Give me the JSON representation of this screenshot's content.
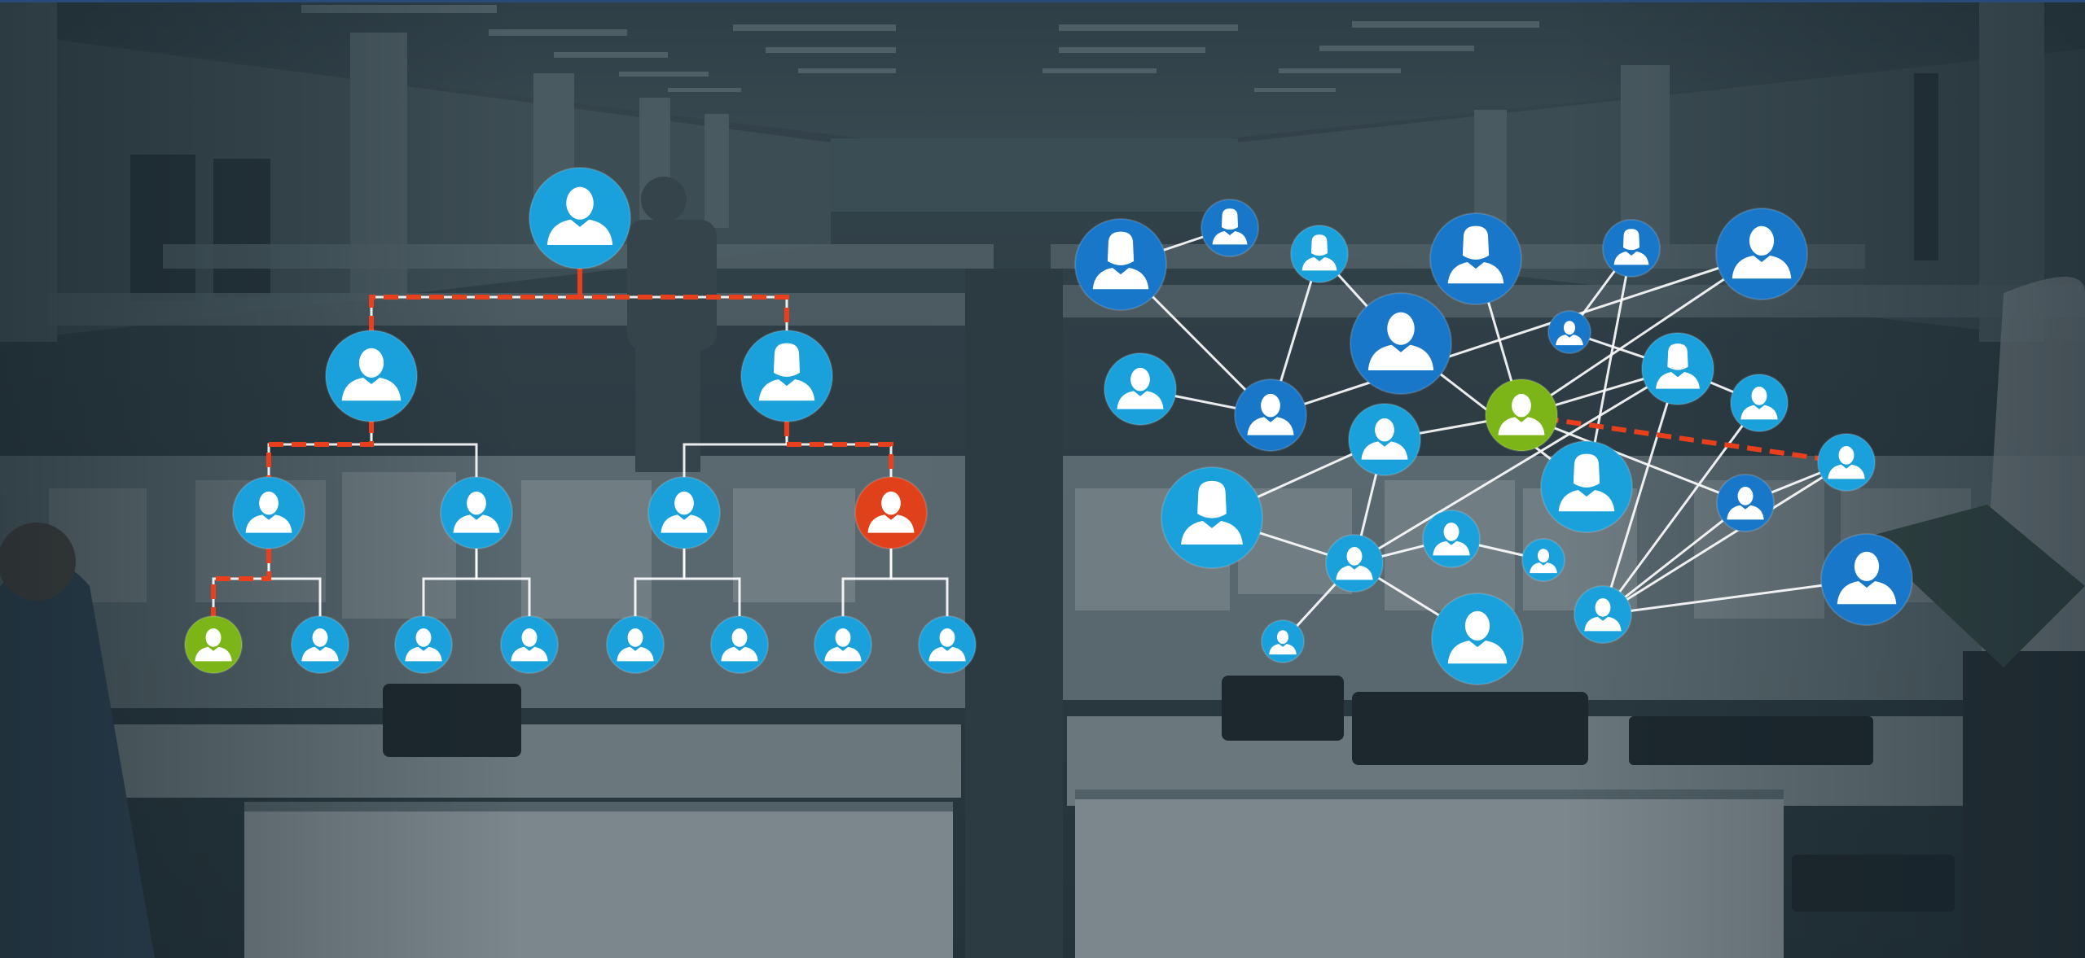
{
  "colors": {
    "blue_light": "#1aa0da",
    "blue_dark": "#1877c9",
    "green": "#7cb518",
    "red": "#e0411a",
    "dashed_red": "#e8401c",
    "link_white": "#ffffff",
    "overlay": "#23343c"
  },
  "icon": "person-icon",
  "hierarchy": {
    "nodes": [
      {
        "id": "h_root",
        "color": "blue_light",
        "size": "xl",
        "shape": "man"
      },
      {
        "id": "h_l1a",
        "color": "blue_light",
        "size": "lg",
        "shape": "man"
      },
      {
        "id": "h_l1b",
        "color": "blue_light",
        "size": "lg",
        "shape": "woman"
      },
      {
        "id": "h_l2a",
        "color": "blue_light",
        "size": "md",
        "shape": "man"
      },
      {
        "id": "h_l2b",
        "color": "blue_light",
        "size": "md",
        "shape": "man"
      },
      {
        "id": "h_l2c",
        "color": "blue_light",
        "size": "md",
        "shape": "man"
      },
      {
        "id": "h_l2d",
        "color": "red",
        "size": "md",
        "shape": "man"
      },
      {
        "id": "h_l3a",
        "color": "green",
        "size": "sm",
        "shape": "man"
      },
      {
        "id": "h_l3b",
        "color": "blue_light",
        "size": "sm",
        "shape": "man"
      },
      {
        "id": "h_l3c",
        "color": "blue_light",
        "size": "sm",
        "shape": "man"
      },
      {
        "id": "h_l3d",
        "color": "blue_light",
        "size": "sm",
        "shape": "man"
      },
      {
        "id": "h_l3e",
        "color": "blue_light",
        "size": "sm",
        "shape": "man"
      },
      {
        "id": "h_l3f",
        "color": "blue_light",
        "size": "sm",
        "shape": "man"
      },
      {
        "id": "h_l3g",
        "color": "blue_light",
        "size": "sm",
        "shape": "man"
      },
      {
        "id": "h_l3h",
        "color": "blue_light",
        "size": "sm",
        "shape": "man"
      }
    ],
    "links": [
      [
        "h_root",
        "h_l1a"
      ],
      [
        "h_root",
        "h_l1b"
      ],
      [
        "h_l1a",
        "h_l2a"
      ],
      [
        "h_l1a",
        "h_l2b"
      ],
      [
        "h_l1b",
        "h_l2c"
      ],
      [
        "h_l1b",
        "h_l2d"
      ],
      [
        "h_l2a",
        "h_l3a"
      ],
      [
        "h_l2a",
        "h_l3b"
      ],
      [
        "h_l2b",
        "h_l3c"
      ],
      [
        "h_l2b",
        "h_l3d"
      ],
      [
        "h_l2c",
        "h_l3e"
      ],
      [
        "h_l2c",
        "h_l3f"
      ],
      [
        "h_l2d",
        "h_l3g"
      ],
      [
        "h_l2d",
        "h_l3h"
      ]
    ],
    "highlight_path": [
      "h_l3a",
      "h_l2a",
      "h_l1a",
      "h_root",
      "h_l1b",
      "h_l2d"
    ]
  },
  "network": {
    "nodes": [
      {
        "id": "n1",
        "color": "blue_dark",
        "size": "lg",
        "shape": "woman"
      },
      {
        "id": "n2",
        "color": "blue_dark",
        "size": "sm",
        "shape": "woman"
      },
      {
        "id": "n3",
        "color": "blue_light",
        "size": "sm",
        "shape": "woman"
      },
      {
        "id": "n4",
        "color": "blue_dark",
        "size": "lg",
        "shape": "woman"
      },
      {
        "id": "n5",
        "color": "blue_dark",
        "size": "sm",
        "shape": "woman"
      },
      {
        "id": "n6",
        "color": "blue_dark",
        "size": "xl",
        "shape": "man"
      },
      {
        "id": "n7",
        "color": "blue_dark",
        "size": "xs",
        "shape": "man"
      },
      {
        "id": "n8",
        "color": "blue_light",
        "size": "md",
        "shape": "man"
      },
      {
        "id": "n9",
        "color": "blue_dark",
        "size": "md",
        "shape": "man"
      },
      {
        "id": "n10",
        "color": "blue_dark",
        "size": "lg",
        "shape": "man"
      },
      {
        "id": "n11",
        "color": "green",
        "size": "md",
        "shape": "man"
      },
      {
        "id": "n12",
        "color": "blue_light",
        "size": "md",
        "shape": "woman"
      },
      {
        "id": "n13",
        "color": "blue_light",
        "size": "sm",
        "shape": "man"
      },
      {
        "id": "n14",
        "color": "blue_light",
        "size": "sm",
        "shape": "man"
      },
      {
        "id": "n15",
        "color": "blue_light",
        "size": "md",
        "shape": "man"
      },
      {
        "id": "n16",
        "color": "blue_light",
        "size": "xl",
        "shape": "woman"
      },
      {
        "id": "n17",
        "color": "blue_light",
        "size": "lg",
        "shape": "woman"
      },
      {
        "id": "n18",
        "color": "blue_dark",
        "size": "sm",
        "shape": "man"
      },
      {
        "id": "n19",
        "color": "blue_light",
        "size": "sm",
        "shape": "man"
      },
      {
        "id": "n20",
        "color": "blue_light",
        "size": "sm",
        "shape": "man"
      },
      {
        "id": "n21",
        "color": "blue_light",
        "size": "xs",
        "shape": "man"
      },
      {
        "id": "n22",
        "color": "blue_light",
        "size": "lg",
        "shape": "man"
      },
      {
        "id": "n23",
        "color": "blue_light",
        "size": "sm",
        "shape": "man"
      },
      {
        "id": "n24",
        "color": "blue_light",
        "size": "xs",
        "shape": "man"
      },
      {
        "id": "n25",
        "color": "blue_dark",
        "size": "lg",
        "shape": "man"
      }
    ],
    "links": [
      [
        "n1",
        "n2"
      ],
      [
        "n1",
        "n9"
      ],
      [
        "n8",
        "n9"
      ],
      [
        "n9",
        "n3"
      ],
      [
        "n9",
        "n10"
      ],
      [
        "n3",
        "n6"
      ],
      [
        "n10",
        "n11"
      ],
      [
        "n4",
        "n11"
      ],
      [
        "n11",
        "n12"
      ],
      [
        "n11",
        "n15"
      ],
      [
        "n11",
        "n18"
      ],
      [
        "n5",
        "n7"
      ],
      [
        "n5",
        "n17"
      ],
      [
        "n6",
        "n17"
      ],
      [
        "n7",
        "n12"
      ],
      [
        "n15",
        "n16"
      ],
      [
        "n15",
        "n19"
      ],
      [
        "n16",
        "n19"
      ],
      [
        "n19",
        "n20"
      ],
      [
        "n19",
        "n21"
      ],
      [
        "n19",
        "n22"
      ],
      [
        "n20",
        "n24"
      ],
      [
        "n12",
        "n23"
      ],
      [
        "n12",
        "n13"
      ],
      [
        "n13",
        "n23"
      ],
      [
        "n23",
        "n14"
      ],
      [
        "n14",
        "n18"
      ],
      [
        "n18",
        "n23"
      ],
      [
        "n23",
        "n25"
      ],
      [
        "n12",
        "n19"
      ]
    ],
    "dashed_link": [
      "n11",
      "n14"
    ]
  }
}
